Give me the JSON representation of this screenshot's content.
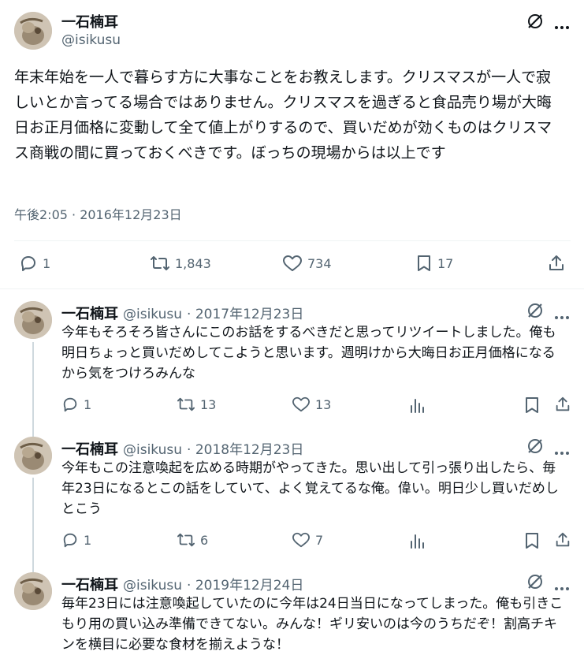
{
  "main_tweet": {
    "name": "一石楠耳",
    "handle": "@isikusu",
    "text": "年末年始を一人で暮らす方に大事なことをお教えします。クリスマスが一人で寂しいとか言ってる場合ではありません。クリスマスを過ぎると食品売り場が大晦日お正月価格に変動して全て値上がりするので、買いだめが効くものはクリスマス商戦の間に買っておくべきです。ぼっちの現場からは以上です",
    "timestamp": "午後2:05 · 2016年12月23日",
    "replies": "1",
    "retweets": "1,843",
    "likes": "734",
    "bookmarks": "17"
  },
  "replies": [
    {
      "name": "一石楠耳",
      "handle": "@isikusu",
      "date": "· 2017年12月23日",
      "text": "今年もそろそろ皆さんにこのお話をするべきだと思ってリツイートしました。俺も明日ちょっと買いだめしてこようと思います。週明けから大晦日お正月価格になるから気をつけろみんな",
      "replies": "1",
      "retweets": "13",
      "likes": "13"
    },
    {
      "name": "一石楠耳",
      "handle": "@isikusu",
      "date": "· 2018年12月23日",
      "text": "今年もこの注意喚起を広める時期がやってきた。思い出して引っ張り出したら、毎年23日になるとこの話をしていて、よく覚えてるな俺。偉い。明日少し買いだめしとこう",
      "replies": "1",
      "retweets": "6",
      "likes": "7"
    },
    {
      "name": "一石楠耳",
      "handle": "@isikusu",
      "date": "· 2019年12月24日",
      "text": "毎年23日には注意喚起していたのに今年は24日当日になってしまった。俺も引きこもり用の買い込み準備できてない。みんな！ギリ安いのは今のうちだぞ！割高チキンを横目に必要な食材を揃えような！"
    }
  ],
  "icons": {
    "grok": "grok-icon",
    "more": "more-icon",
    "reply": "reply-icon",
    "retweet": "retweet-icon",
    "like": "like-icon",
    "bookmark": "bookmark-icon",
    "share": "share-icon",
    "views": "views-icon"
  },
  "colors": {
    "text": "#0f1419",
    "secondary": "#536471",
    "divider": "#eff3f4",
    "thread_line": "#cfd9de"
  }
}
